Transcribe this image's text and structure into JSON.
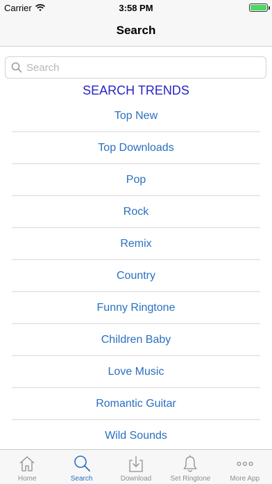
{
  "status_bar": {
    "carrier": "Carrier",
    "time": "3:58 PM"
  },
  "nav": {
    "title": "Search"
  },
  "search": {
    "placeholder": "Search",
    "value": ""
  },
  "section_title": "SEARCH TRENDS",
  "trends": [
    "Top New",
    "Top Downloads",
    "Pop",
    "Rock",
    "Remix",
    "Country",
    "Funny Ringtone",
    "Children Baby",
    "Love Music",
    "Romantic Guitar",
    "Wild Sounds"
  ],
  "tabs": [
    {
      "label": "Home",
      "icon": "home-icon",
      "active": false
    },
    {
      "label": "Search",
      "icon": "search-icon",
      "active": true
    },
    {
      "label": "Download",
      "icon": "download-icon",
      "active": false
    },
    {
      "label": "Set Ringtone",
      "icon": "bell-icon",
      "active": false
    },
    {
      "label": "More App",
      "icon": "more-icon",
      "active": false
    }
  ],
  "colors": {
    "accent": "#2a6fbf",
    "section_title": "#2a23c6",
    "battery": "#4cd964",
    "inactive": "#8e8e93"
  }
}
